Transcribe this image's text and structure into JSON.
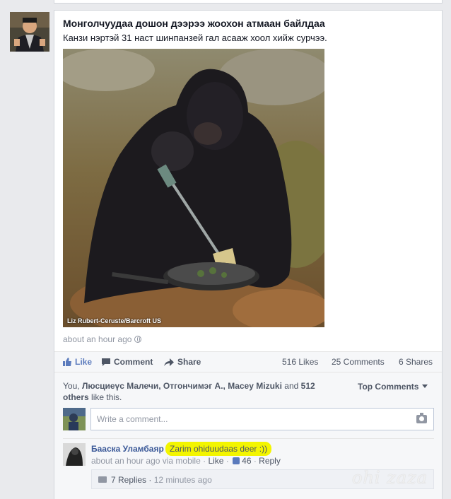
{
  "post": {
    "title": "Монголчуудаа дошон дээрээ жоохон атмаан байлдаа",
    "text": "Канзи нэртэй 31 наст шинпанзей гал асааж хоол хийж сурчээ.",
    "photo_credit": "Liz Rubert-Ceruste/Barcroft US",
    "time": "about an hour ago"
  },
  "actions": {
    "like": "Like",
    "comment": "Comment",
    "share": "Share"
  },
  "stats": {
    "likes": "516 Likes",
    "comments": "25 Comments",
    "shares": "6 Shares"
  },
  "likers": {
    "prefix": "You,",
    "names": "Люсциеүс Малечи, Отгончимэг А., Macey Mizuki",
    "and": "and",
    "others": "512 others",
    "suffix": "like this."
  },
  "top_comments": "Top Comments",
  "composer": {
    "placeholder": "Write a comment..."
  },
  "comment": {
    "author": "Бааска Уламбаяр",
    "text": "Zarim ohiduudaas deer :))",
    "time": "about an hour ago via mobile",
    "like": "Like",
    "like_count": "46",
    "reply": "Reply",
    "replies": "7 Replies",
    "replies_time": "12 minutes ago"
  },
  "watermark": "ohi zaza",
  "colors": {
    "link": "#3b5998",
    "like_active": "#5b7bbd",
    "highlight": "#f3f500"
  }
}
